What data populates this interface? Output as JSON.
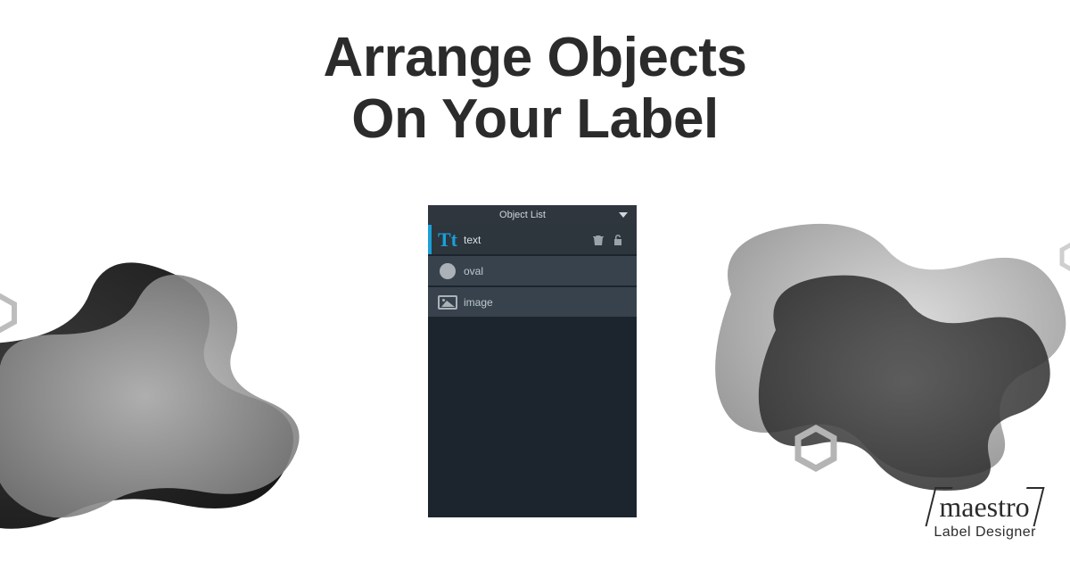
{
  "heading": {
    "line1": "Arrange Objects",
    "line2": "On Your Label"
  },
  "panel": {
    "title": "Object List",
    "items": [
      {
        "icon": "text-icon",
        "label": "text",
        "selected": true
      },
      {
        "icon": "circle-icon",
        "label": "oval",
        "selected": false
      },
      {
        "icon": "image-icon",
        "label": "image",
        "selected": false
      }
    ],
    "actions": {
      "trash_tooltip": "Delete",
      "lock_tooltip": "Unlock"
    }
  },
  "brand": {
    "name": "maestro",
    "sub": "Label Designer"
  },
  "colors": {
    "accent": "#1aa0d8",
    "panel_bg": "#1c252e",
    "row_bg": "#37424c",
    "text_dark": "#2b2b2b"
  }
}
